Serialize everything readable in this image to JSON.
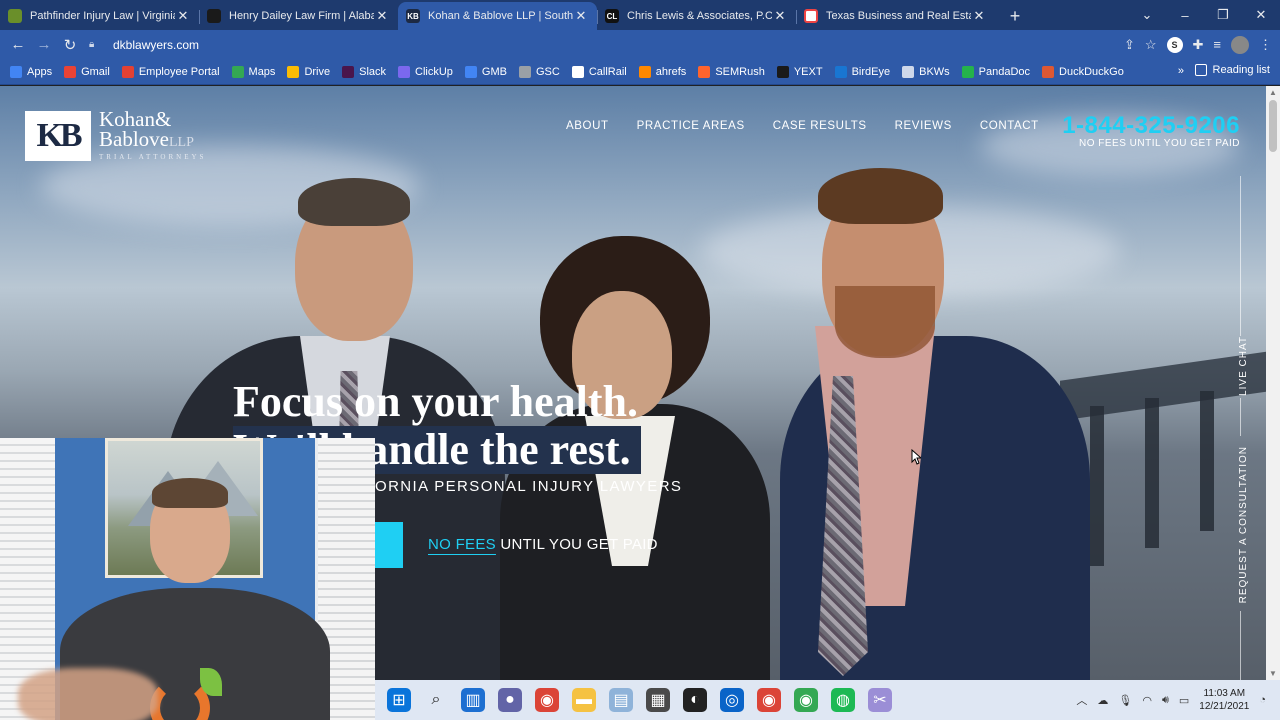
{
  "tabs": [
    {
      "title": "Pathfinder Injury Law | Virginia W",
      "favicon_color": "#6a8f2a",
      "active": false
    },
    {
      "title": "Henry Dailey Law Firm | Alabama",
      "favicon_color": "#1a1a1a",
      "active": false
    },
    {
      "title": "Kohan & Bablove LLP | Southern",
      "favicon_color": "#1d2a44",
      "favicon_text": "KB",
      "active": true
    },
    {
      "title": "Chris Lewis & Associates, P.C. | C",
      "favicon_color": "#111111",
      "favicon_text": "CL",
      "active": false
    },
    {
      "title": "Texas Business and Real Estate La",
      "favicon_color": "#ffffff",
      "active": false
    }
  ],
  "window_controls": {
    "minimize": "–",
    "maximize": "❐",
    "close": "✕",
    "tab_search": "⌄"
  },
  "toolbar": {
    "back": "←",
    "forward": "→",
    "reload": "↻",
    "url": "dkblawyers.com"
  },
  "bookmarks": [
    {
      "label": "Apps",
      "color": "#4285f4"
    },
    {
      "label": "Gmail",
      "color": "#ea4335"
    },
    {
      "label": "Employee Portal",
      "color": "#e34133"
    },
    {
      "label": "Maps",
      "color": "#34a853"
    },
    {
      "label": "Drive",
      "color": "#fbbc04"
    },
    {
      "label": "Slack",
      "color": "#4a154b"
    },
    {
      "label": "ClickUp",
      "color": "#7b68ee"
    },
    {
      "label": "GMB",
      "color": "#4285f4"
    },
    {
      "label": "GSC",
      "color": "#9aa0a6"
    },
    {
      "label": "CallRail",
      "color": "#ffffff"
    },
    {
      "label": "ahrefs",
      "color": "#ff8800"
    },
    {
      "label": "SEMRush",
      "color": "#ff642d"
    },
    {
      "label": "YEXT",
      "color": "#1a1a1a"
    },
    {
      "label": "BirdEye",
      "color": "#1976d2"
    },
    {
      "label": "BKWs",
      "color": "#cfd8ea"
    },
    {
      "label": "PandaDoc",
      "color": "#25b34b"
    },
    {
      "label": "DuckDuckGo",
      "color": "#de5833"
    }
  ],
  "bookmarks_more": "»",
  "reading_list": "Reading list",
  "site": {
    "logo_mark": "KB",
    "logo_line1": "Kohan&",
    "logo_line2": "Bablove",
    "logo_llp": "LLP",
    "logo_tag": "TRIAL ATTORNEYS",
    "nav": [
      "ABOUT",
      "PRACTICE AREAS",
      "CASE RESULTS",
      "REVIEWS",
      "CONTACT"
    ],
    "phone": "1-844-325-9206",
    "phone_sub": "NO FEES UNTIL YOU GET PAID",
    "headline_1": "Focus on your health.",
    "headline_2": "We'll handle the rest.",
    "subline": "ORNIA PERSONAL INJURY LAWYERS",
    "nofees_hl": "NO FEES",
    "nofees_rest": " UNTIL YOU GET PAID",
    "live_chat": "LIVE CHAT",
    "request": "REQUEST A CONSULTATION"
  },
  "taskbar": {
    "icons": [
      {
        "name": "windows-start-icon",
        "color": "#0a74da",
        "glyph": "⊞"
      },
      {
        "name": "search-icon",
        "color": "transparent",
        "glyph": "⌕"
      },
      {
        "name": "widgets-icon",
        "color": "#1d6fd1",
        "glyph": "▥"
      },
      {
        "name": "teams-chat-icon",
        "color": "#6264a7",
        "glyph": "●"
      },
      {
        "name": "chrome-icon",
        "color": "#db4437",
        "glyph": "◉"
      },
      {
        "name": "file-explorer-icon",
        "color": "#f5c242",
        "glyph": "▬"
      },
      {
        "name": "notepad-icon",
        "color": "#8fb3d9",
        "glyph": "▤"
      },
      {
        "name": "calculator-icon",
        "color": "#4a4a4a",
        "glyph": "▦"
      },
      {
        "name": "obs-icon",
        "color": "#222222",
        "glyph": "◐"
      },
      {
        "name": "outlook-icon",
        "color": "#0a64c8",
        "glyph": "◎"
      },
      {
        "name": "chrome-active-icon",
        "color": "#db4437",
        "glyph": "◉"
      },
      {
        "name": "chrome-alt-icon",
        "color": "#34a853",
        "glyph": "◉"
      },
      {
        "name": "spotify-icon",
        "color": "#1db954",
        "glyph": "◍"
      },
      {
        "name": "snipping-tool-icon",
        "color": "#9b8ed6",
        "glyph": "✂"
      }
    ],
    "time": "11:03 AM",
    "date": "12/21/2021"
  }
}
